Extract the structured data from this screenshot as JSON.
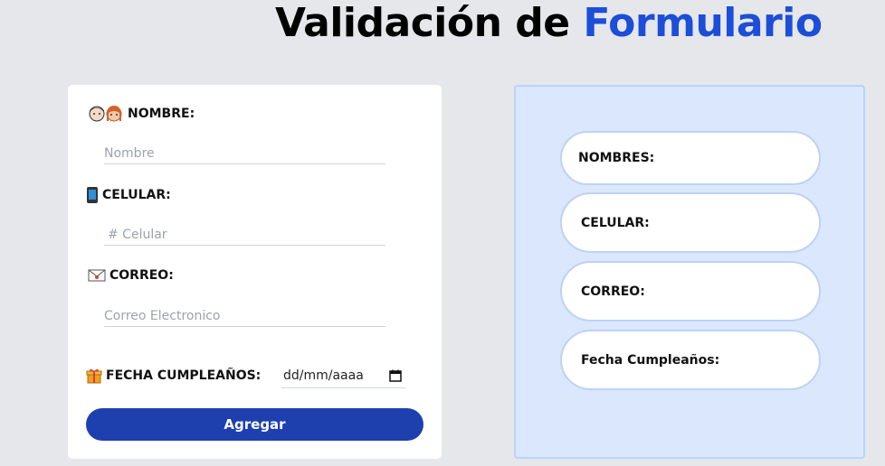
{
  "header": {
    "title_part1": "Validación de",
    "title_part2": "Formulario"
  },
  "form": {
    "fields": [
      {
        "icon": "people-icon",
        "label": "NOMBRE:",
        "placeholder": "Nombre"
      },
      {
        "icon": "phone-icon",
        "label": "CELULAR:",
        "placeholder": "# Celular"
      },
      {
        "icon": "envelope-icon",
        "label": "CORREO:",
        "placeholder": "Correo Electronico"
      }
    ],
    "birthday": {
      "icon": "gift-icon",
      "label": "FECHA CUMPLEAÑOS:",
      "value": "dd/mm/aaaa"
    },
    "submit_label": "Agregar"
  },
  "preview": {
    "items": [
      {
        "label": "NOMBRES:"
      },
      {
        "label": "CELULAR:"
      },
      {
        "label": "CORREO:"
      },
      {
        "label": "Fecha Cumpleaños:"
      }
    ]
  },
  "colors": {
    "accent": "#1d4ed8",
    "button": "#1e40af",
    "panel": "#dbe7fc",
    "background": "#e5e7eb"
  }
}
